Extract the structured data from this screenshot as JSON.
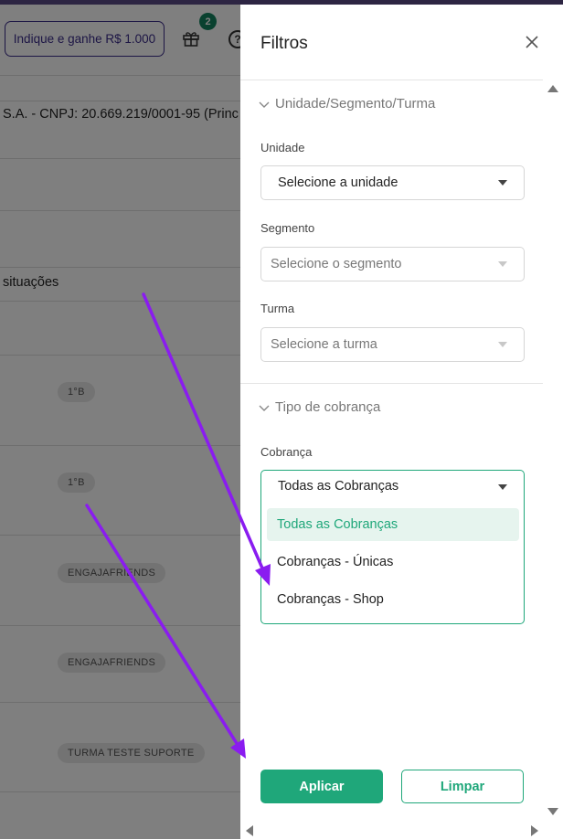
{
  "header": {
    "refer_label": "Indique e ganhe R$ 1.000",
    "gift_badge": "2",
    "help_icon": "?"
  },
  "background": {
    "company_text": "S.A. - CNPJ: 20.669.219/0001-95 (Princ",
    "situations_text": "situações",
    "chips": [
      "1°B",
      "1°B",
      "ENGAJAFRIENDS",
      "ENGAJAFRIENDS",
      "TURMA TESTE SUPORTE"
    ]
  },
  "drawer": {
    "title": "Filtros",
    "sections": {
      "unit_section": "Unidade/Segmento/Turma",
      "billing_section": "Tipo de cobrança"
    },
    "fields": {
      "unit": {
        "label": "Unidade",
        "placeholder": "Selecione a unidade"
      },
      "segment": {
        "label": "Segmento",
        "placeholder": "Selecione o segmento"
      },
      "class": {
        "label": "Turma",
        "placeholder": "Selecione a turma"
      },
      "billing": {
        "label": "Cobrança",
        "value": "Todas as Cobranças",
        "options": [
          "Todas as Cobranças",
          "Cobranças - Únicas",
          "Cobranças - Shop"
        ]
      }
    },
    "buttons": {
      "apply": "Aplicar",
      "clear": "Limpar"
    }
  },
  "colors": {
    "accent": "#1fa77a",
    "annotation_arrow": "#8a1cf0",
    "badge": "#12835f"
  }
}
